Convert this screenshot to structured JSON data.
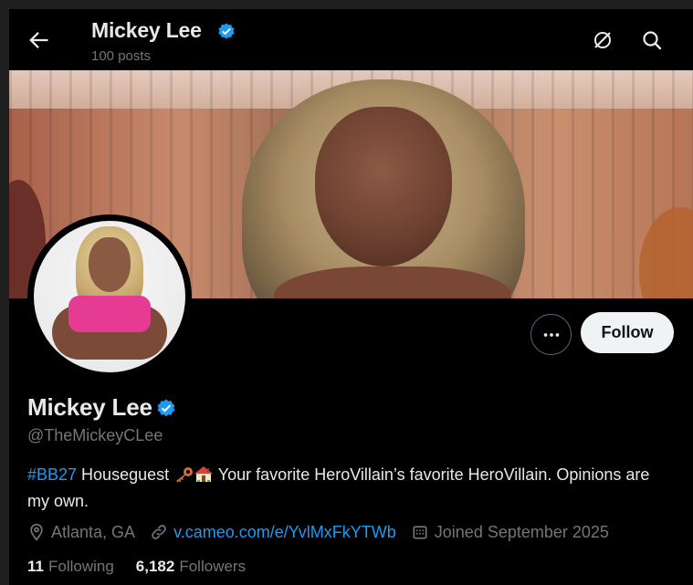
{
  "header": {
    "back_icon": "arrow-left-icon",
    "title": "Mickey Lee",
    "posts": "100 posts",
    "grok_icon": "grok-icon",
    "search_icon": "search-icon"
  },
  "banner": {
    "description_icon": "banner-image"
  },
  "profile": {
    "name": "Mickey Lee",
    "verified_icon": "verified-badge-icon",
    "handle": "@TheMickeyCLee",
    "follow_label": "Follow",
    "more_icon": "more-icon",
    "bio": {
      "hashtag": "#BB27",
      "text1": " Houseguest ",
      "text2": " Your favorite HeroVillain’s favorite HeroVillain. Opinions are my own."
    },
    "location": "Atlanta, GA",
    "website": "v.cameo.com/e/YvlMxFkYTWb",
    "joined": "Joined September 2025",
    "following_count": "11",
    "following_label": "Following",
    "followers_count": "6,182",
    "followers_label": "Followers"
  },
  "colors": {
    "background": "#000000",
    "accent": "#1d9bf0",
    "muted": "#71767b",
    "text": "#e7e9ea"
  }
}
